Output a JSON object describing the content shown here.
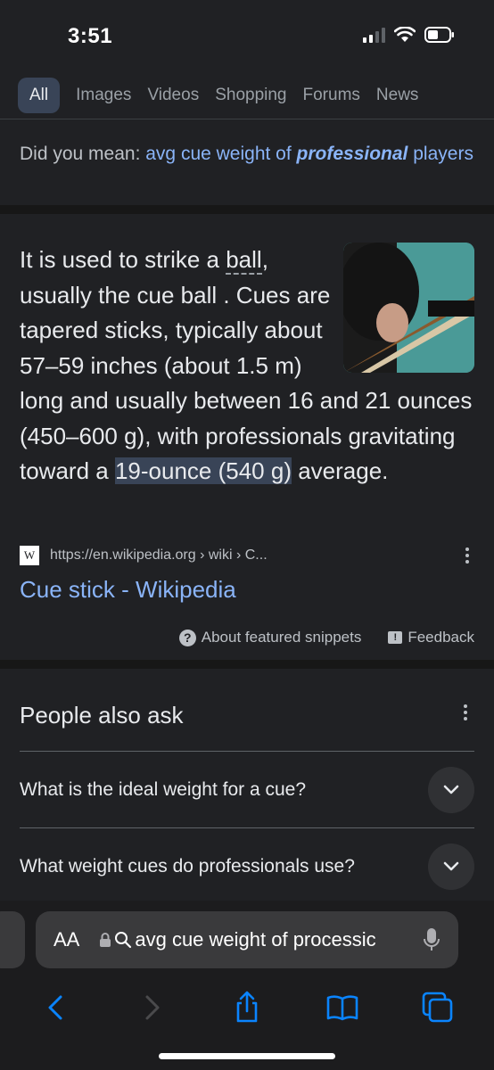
{
  "status": {
    "time": "3:51"
  },
  "tabs": [
    {
      "label": "All",
      "active": true
    },
    {
      "label": "Images"
    },
    {
      "label": "Videos"
    },
    {
      "label": "Shopping"
    },
    {
      "label": "Forums"
    },
    {
      "label": "News"
    }
  ],
  "did_you_mean": {
    "prefix": "Did you mean:",
    "link_before": "avg cue weight of",
    "link_emphasis": "professional",
    "link_after": "players"
  },
  "snippet": {
    "text_1": "It is used to strike a ",
    "text_ball": "ball",
    "text_2": ", usually the cue ball . Cues are tapered sticks, typically about 57–59 inches (about 1.5 m) long and usually between 16 and 21 ounces (450–600 g), with professionals gravitating toward a ",
    "highlight": "19-ounce (540 g)",
    "text_3": " average.",
    "source_url": "https://en.wikipedia.org › wiki › C...",
    "source_logo": "W",
    "result_title": "Cue stick - Wikipedia",
    "about_label": "About featured snippets",
    "feedback_label": "Feedback"
  },
  "people_also_ask": {
    "title": "People also ask",
    "questions": [
      "What is the ideal weight for a cue?",
      "What weight cues do professionals use?"
    ]
  },
  "browser": {
    "aa_label": "AA",
    "url_text": "avg cue weight of processic"
  },
  "icons": {
    "signal": "signal-icon",
    "wifi": "wifi-icon",
    "battery": "battery-icon",
    "lock": "lock-icon",
    "search": "search-icon",
    "mic": "microphone-icon",
    "back": "back-icon",
    "forward": "forward-icon",
    "share": "share-icon",
    "bookmarks": "bookmarks-icon",
    "tabs": "tabs-icon"
  },
  "colors": {
    "background": "#202124",
    "link": "#8ab4f8",
    "highlight": "#394457",
    "ios_blue": "#0a84ff"
  }
}
